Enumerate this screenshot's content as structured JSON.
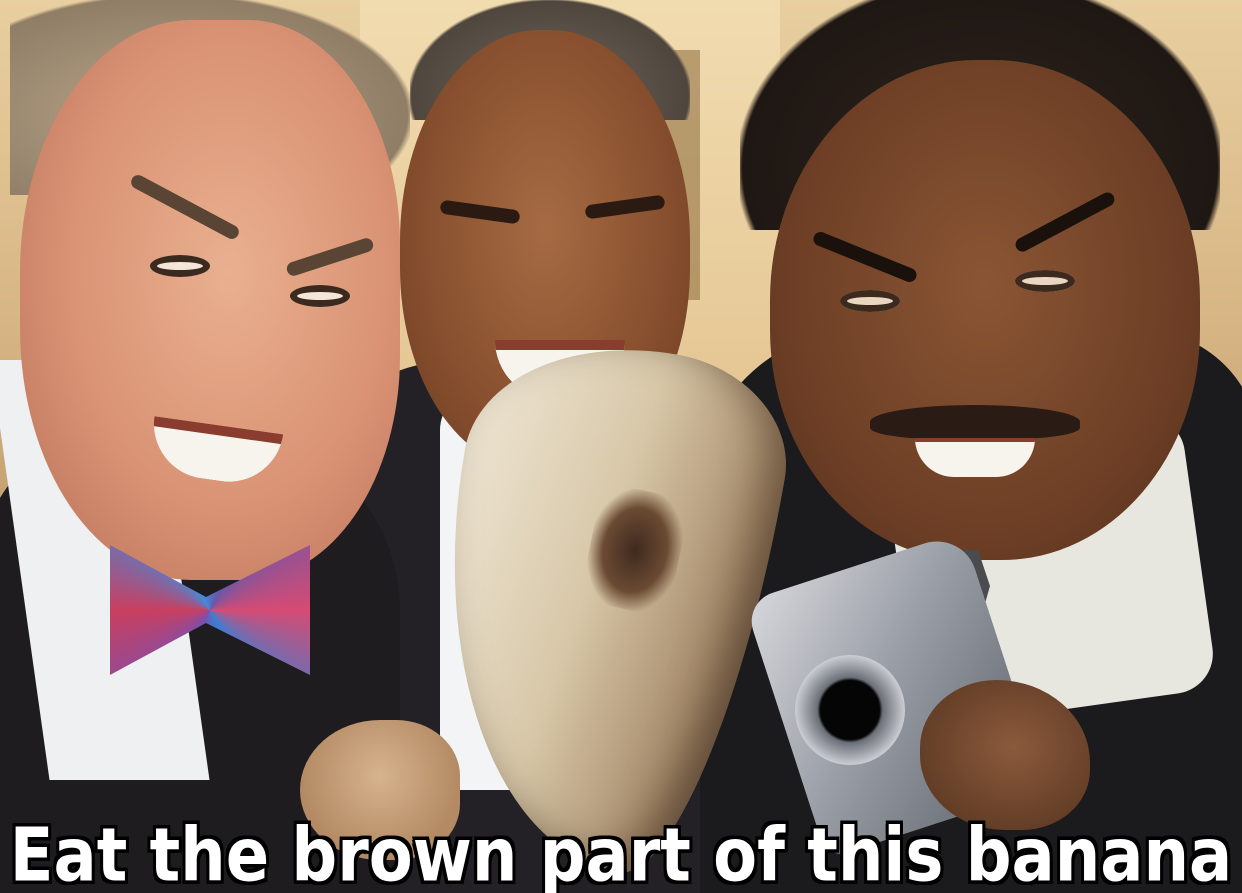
{
  "caption": "Eat the brown part of this banana"
}
